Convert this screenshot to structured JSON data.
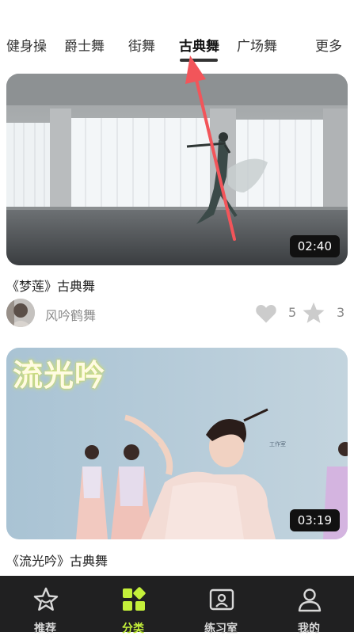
{
  "tabs": [
    {
      "label": "健身操"
    },
    {
      "label": "爵士舞"
    },
    {
      "label": "街舞"
    },
    {
      "label": "古典舞",
      "active": true
    },
    {
      "label": "广场舞"
    },
    {
      "label": "更多"
    }
  ],
  "videos": [
    {
      "title": "《梦莲》古典舞",
      "duration": "02:40",
      "author": "风吟鹤舞",
      "likes": "5",
      "favorites": "3"
    },
    {
      "title": "《流光吟》古典舞",
      "duration": "03:19",
      "overlay_text": "流光吟"
    }
  ],
  "bottom_nav": [
    {
      "label": "推荐",
      "icon": "star-outline-icon"
    },
    {
      "label": "分类",
      "icon": "category-grid-icon",
      "active": true
    },
    {
      "label": "练习室",
      "icon": "practice-room-icon"
    },
    {
      "label": "我的",
      "icon": "user-icon"
    }
  ],
  "colors": {
    "accent": "#c4f03a",
    "nav_bg": "#202021",
    "annotation_arrow": "#f2555a"
  }
}
